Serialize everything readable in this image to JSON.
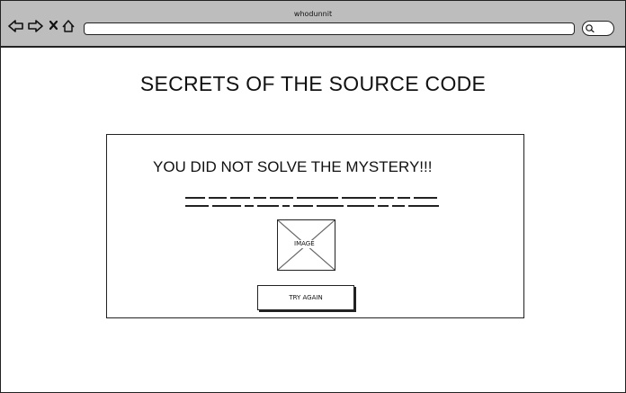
{
  "browser": {
    "title": "whodunnit",
    "address": "",
    "nav_icons": [
      "back-arrow-icon",
      "forward-arrow-icon",
      "close-icon",
      "home-icon"
    ],
    "search_icon": "search-icon"
  },
  "page": {
    "title": "SECRETS OF THE SOURCE CODE"
  },
  "result": {
    "heading": "YOU DID NOT SOLVE THE MYSTERY!!!",
    "text_line_1": "",
    "text_line_2": "",
    "image_label": "IMAGE",
    "button_label": "TRY AGAIN"
  }
}
